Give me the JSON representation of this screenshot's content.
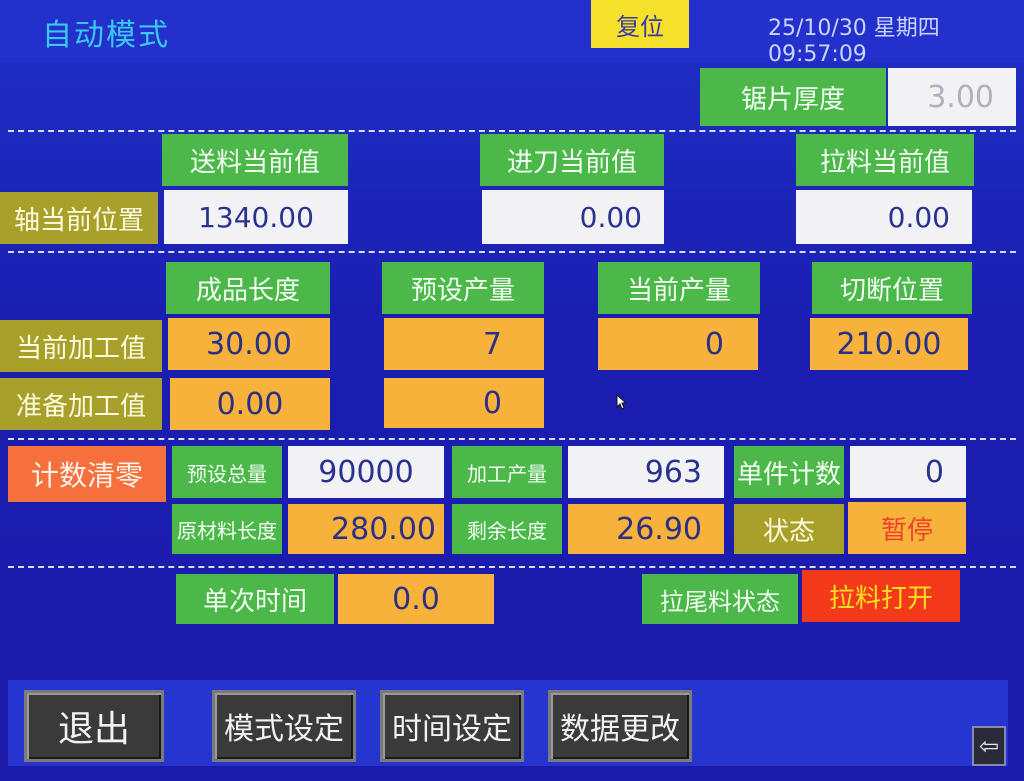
{
  "header": {
    "title": "自动模式",
    "reset_label": "复位",
    "datetime": "25/10/30 星期四 09:57:09"
  },
  "blade": {
    "label": "锯片厚度",
    "value": "3.00"
  },
  "axis": {
    "row_label": "轴当前位置",
    "feed_label": "送料当前值",
    "feed_value": "1340.00",
    "knife_label": "进刀当前值",
    "knife_value": "0.00",
    "pull_label": "拉料当前值",
    "pull_value": "0.00"
  },
  "process": {
    "col_length": "成品长度",
    "col_preset_qty": "预设产量",
    "col_current_qty": "当前产量",
    "col_cut_pos": "切断位置",
    "current_label": "当前加工值",
    "current_length": "30.00",
    "current_preset": "7",
    "current_qty": "0",
    "current_cut": "210.00",
    "prepare_label": "准备加工值",
    "prepare_length": "0.00",
    "prepare_preset": "0"
  },
  "counts": {
    "clear_label": "计数清零",
    "preset_total_label": "预设总量",
    "preset_total_value": "90000",
    "processed_label": "加工产量",
    "processed_value": "963",
    "unit_count_label": "单件计数",
    "unit_count_value": "0",
    "raw_length_label": "原材料长度",
    "raw_length_value": "280.00",
    "remaining_label": "剩余长度",
    "remaining_value": "26.90",
    "state_label": "状态",
    "state_value": "暂停"
  },
  "timing": {
    "single_time_label": "单次时间",
    "single_time_value": "0.0",
    "tail_state_label": "拉尾料状态",
    "tail_state_value": "拉料打开"
  },
  "footer": {
    "exit": "退出",
    "mode_setting": "模式设定",
    "time_setting": "时间设定",
    "data_change": "数据更改",
    "back_icon": "⇦"
  },
  "colors": {
    "background": "#1d22b8",
    "label_green": "#4cb84a",
    "value_orange": "#f6b23a",
    "alert_red": "#f43a1a"
  }
}
